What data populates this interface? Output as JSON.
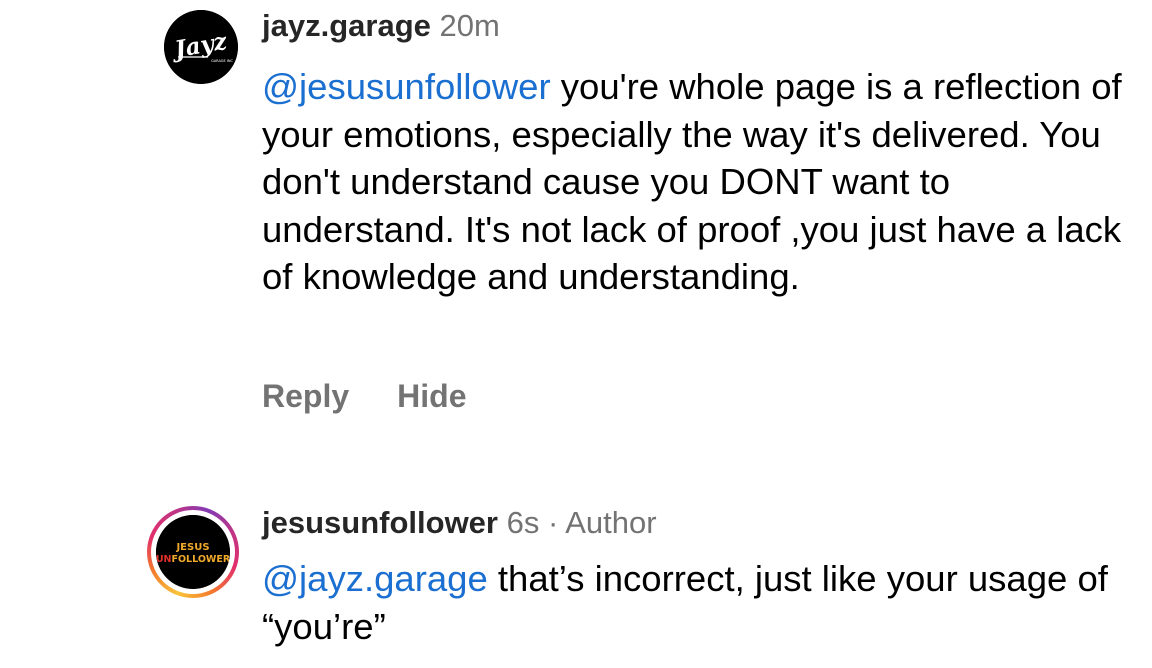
{
  "comments": [
    {
      "avatar": {
        "icon": "jayz-garage-logo",
        "logo_text": "Jayz",
        "logo_subtext": "GARAGE INC"
      },
      "username": "jayz.garage",
      "time": "20m",
      "mention": "@jesusunfollower",
      "text": " you're whole page is a reflection of your emotions, especially the way it's delivered.  You don't understand cause you DONT want to understand. It's not lack of proof ,you just have a lack of knowledge and understanding.",
      "actions": {
        "reply": "Reply",
        "hide": "Hide"
      }
    },
    {
      "avatar": {
        "icon": "jesus-unfollower-logo",
        "logo_line1": "JESUS",
        "logo_line2_a": "UN",
        "logo_line2_b": "FOLLOWER",
        "has_story_ring": true
      },
      "username": "jesusunfollower",
      "time": "6s",
      "separator": "·",
      "badge": "Author",
      "mention": "@jayz.garage",
      "text": " that’s incorrect, just like your usage of “you’re”"
    }
  ],
  "colors": {
    "mention": "#1a6fd1",
    "username": "#262626",
    "secondary": "#737373",
    "body": "#000000"
  }
}
